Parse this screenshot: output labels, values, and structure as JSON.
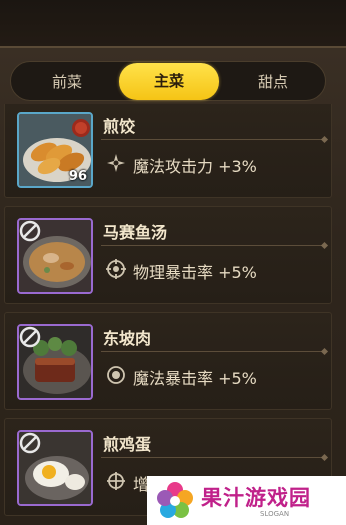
{
  "tabs": [
    {
      "label": "前菜",
      "selected": false
    },
    {
      "label": "主菜",
      "selected": true
    },
    {
      "label": "甜点",
      "selected": false
    }
  ],
  "dishes": [
    {
      "name": "煎饺",
      "buff": "魔法攻击力 +3%",
      "count": "96",
      "frame": "blue",
      "buff_icon": "sparkle-icon",
      "locked": false
    },
    {
      "name": "马赛鱼汤",
      "buff": "物理暴击率 +5%",
      "frame": "purple",
      "buff_icon": "crosshair-icon",
      "locked": true
    },
    {
      "name": "东坡肉",
      "buff": "魔法暴击率 +5%",
      "frame": "purple",
      "buff_icon": "target-icon",
      "locked": true
    },
    {
      "name": "煎鸡蛋",
      "buff": "增",
      "frame": "purple",
      "buff_icon": "crosshair-plus-icon",
      "locked": true
    }
  ],
  "watermark": {
    "text": "果汁游戏园",
    "slogan": "SLOGAN"
  },
  "colors": {
    "tab_active": "#f5c415",
    "frame_blue": "#5aa7c9",
    "frame_purple": "#9a6ad0",
    "watermark_text": "#c0218a"
  }
}
